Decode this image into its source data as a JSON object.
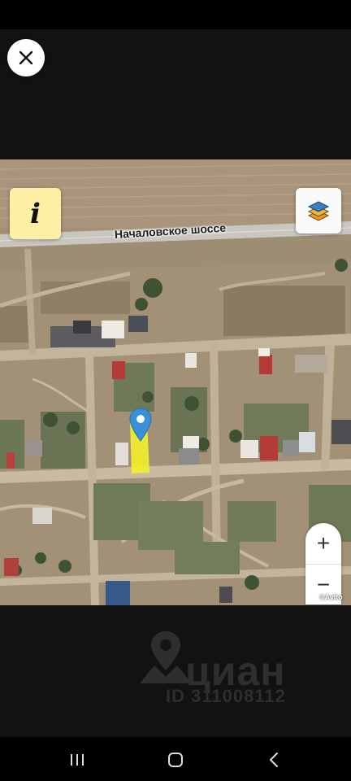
{
  "map": {
    "street_label": "Началовское шоссе",
    "info_label": "i",
    "zoom_in_label": "+",
    "zoom_out_label": "−",
    "attribution": "©Avito"
  },
  "watermark": {
    "brand": "циан",
    "listing_id": "ID 311008112"
  },
  "colors": {
    "info_button_bg": "#fdf0a6",
    "pin": "#3a8fd9",
    "plot_highlight": "#f3ef2a",
    "layer_top": "#3b7fc2",
    "layer_mid": "#f2b43a",
    "layer_bottom": "#e89a2a"
  },
  "icons": {
    "close": "close-icon",
    "info": "info-icon",
    "layers": "layers-icon",
    "pin": "location-pin-icon",
    "recents": "recents-icon",
    "home": "home-icon",
    "back": "back-icon"
  }
}
